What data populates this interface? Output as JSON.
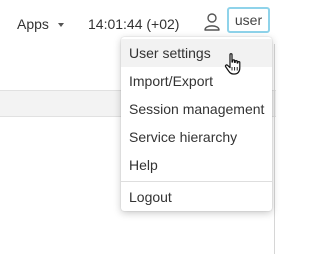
{
  "topbar": {
    "apps_label": "Apps",
    "clock": "14:01:44 (+02)",
    "user_label": "user"
  },
  "menu": {
    "items": [
      "User settings",
      "Import/Export",
      "Session management",
      "Service hierarchy",
      "Help",
      "Logout"
    ]
  },
  "colors": {
    "user_button_border": "#8fd3ea",
    "menu_hover": "#f2f2f2"
  },
  "icons": {
    "user": "user-icon",
    "caret": "chevron-down-icon",
    "cursor": "hand-pointer-icon"
  }
}
